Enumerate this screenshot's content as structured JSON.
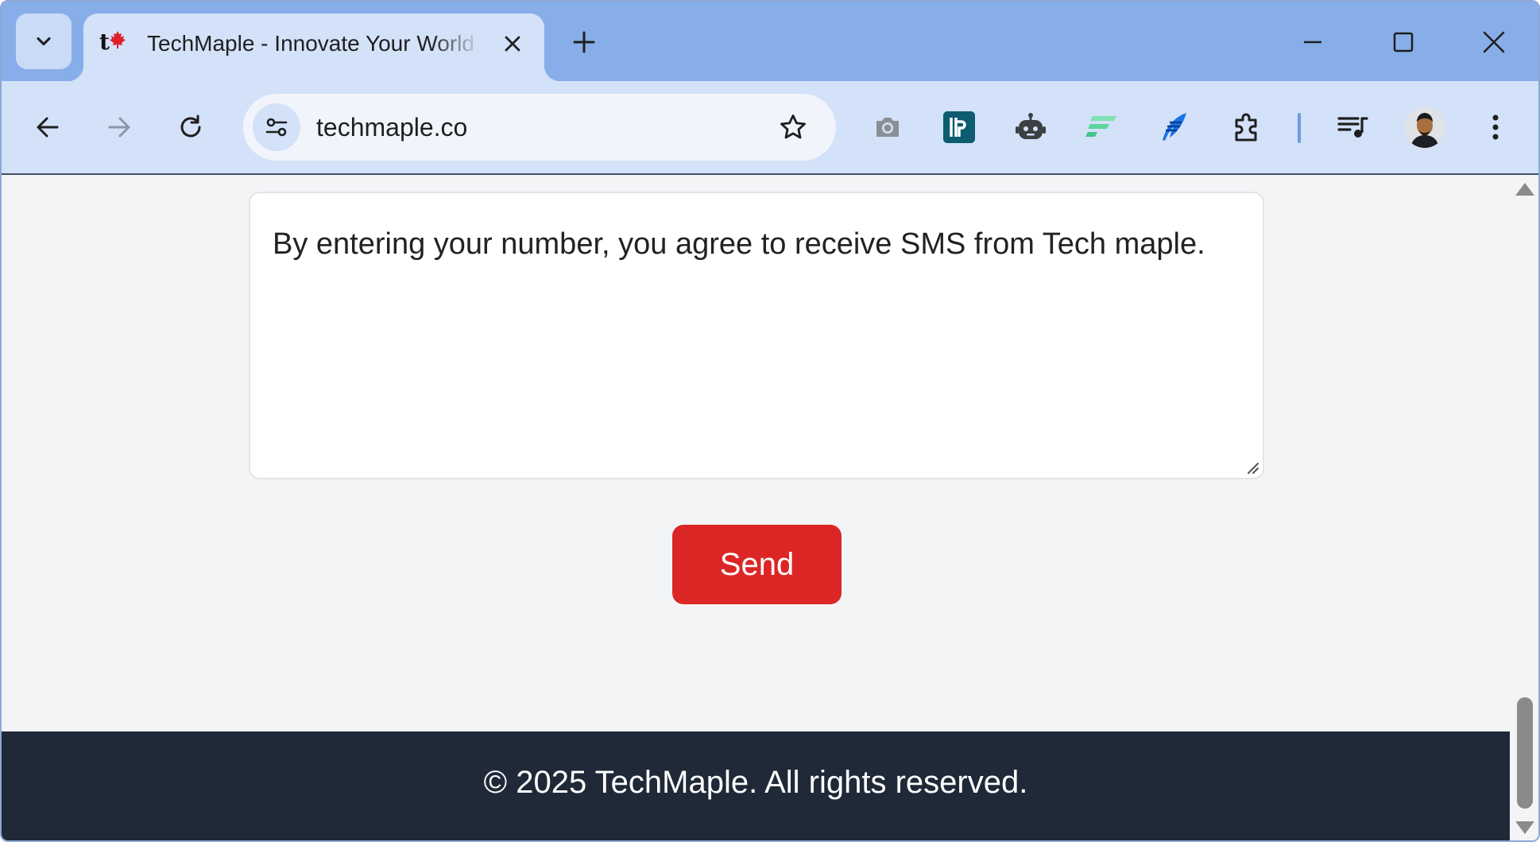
{
  "browser": {
    "tab": {
      "title": "TechMaple - Innovate Your World",
      "favicon_text": "t"
    },
    "address_bar": {
      "url": "techmaple.co"
    },
    "extensions": [
      "camera-icon",
      "dashlane-icon",
      "robot-icon",
      "feedly-icon",
      "quill-icon",
      "extensions-puzzle-icon"
    ]
  },
  "page": {
    "message_box": {
      "value": "By entering your number, you agree to receive SMS from Tech maple."
    },
    "send_button": {
      "label": "Send"
    },
    "footer": {
      "text": "© 2025 TechMaple. All rights reserved."
    }
  },
  "colors": {
    "accent_button": "#dc2626",
    "footer_bg": "#1f2937",
    "page_bg": "#f3f4f6",
    "tabstrip_bg": "#88aee9",
    "toolbar_bg": "#d3e2f8"
  }
}
